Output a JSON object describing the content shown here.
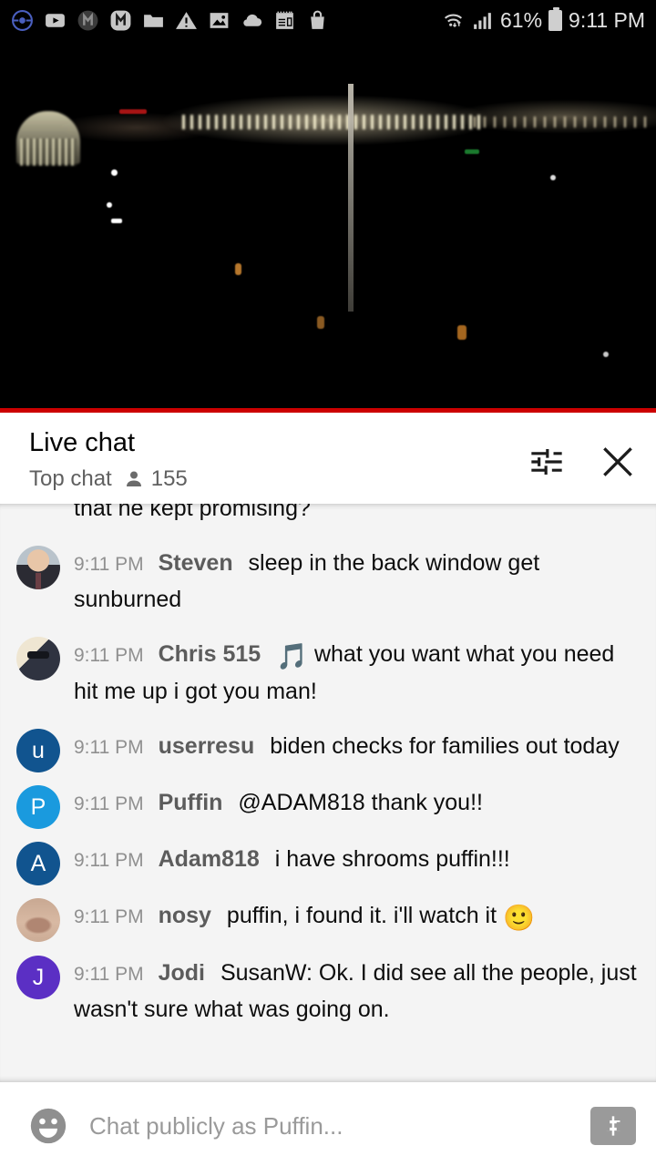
{
  "statusbar": {
    "icons": [
      {
        "name": "pokeball-icon"
      },
      {
        "name": "youtube-icon"
      },
      {
        "name": "m-circle-dark-icon"
      },
      {
        "name": "m-rounded-icon"
      },
      {
        "name": "folder-icon"
      },
      {
        "name": "warning-triangle-icon"
      },
      {
        "name": "image-icon"
      },
      {
        "name": "cloud-icon"
      },
      {
        "name": "notes-icon"
      },
      {
        "name": "shopping-bag-icon"
      }
    ],
    "wifi_icon": "wifi-icon",
    "signal_icon": "cell-signal-icon",
    "battery_percent": "61%",
    "battery_icon": "battery-icon",
    "clock": "9:11 PM"
  },
  "player": {
    "progress_color": "#cc0000",
    "progress_percent": 100
  },
  "chat": {
    "title": "Live chat",
    "mode_label": "Top chat",
    "viewer_icon": "person-icon",
    "viewer_count": "155",
    "settings_icon": "tune-icon",
    "close_icon": "close-icon",
    "messages": [
      {
        "clipped": true,
        "avatar": {
          "type": "none"
        },
        "time": "",
        "author": "",
        "text": "that he kept promising?"
      },
      {
        "avatar": {
          "type": "photo",
          "style": "ph-steven",
          "name": "avatar-steven"
        },
        "time": "9:11 PM",
        "author": "Steven",
        "text": "sleep in the back window get sunburned"
      },
      {
        "avatar": {
          "type": "photo",
          "style": "ph-chris",
          "name": "avatar-chris-515"
        },
        "time": "9:11 PM",
        "author": "Chris 515",
        "emoji": "🎵",
        "text": "what you want what you need hit me up i got you man!"
      },
      {
        "avatar": {
          "type": "letter",
          "letter": "u",
          "color": "#11548f",
          "name": "avatar-userresu"
        },
        "time": "9:11 PM",
        "author": "userresu",
        "text": "biden checks for families out today"
      },
      {
        "avatar": {
          "type": "letter",
          "letter": "P",
          "color": "#1a9ade",
          "name": "avatar-puffin"
        },
        "time": "9:11 PM",
        "author": "Puffin",
        "text": "@ADAM818 thank you!!"
      },
      {
        "avatar": {
          "type": "letter",
          "letter": "A",
          "color": "#11548f",
          "name": "avatar-adam818"
        },
        "time": "9:11 PM",
        "author": "Adam818",
        "text": "i have shrooms puffin!!!"
      },
      {
        "avatar": {
          "type": "photo",
          "style": "ph-nosy",
          "name": "avatar-nosy"
        },
        "time": "9:11 PM",
        "author": "nosy",
        "text": "puffin, i found it. i'll watch it ",
        "trailing_emoji": "🙂"
      },
      {
        "avatar": {
          "type": "letter",
          "letter": "J",
          "color": "#5b2fc4",
          "name": "avatar-jodi"
        },
        "time": "9:11 PM",
        "author": "Jodi",
        "text": "SusanW: Ok. I did see all the people, just wasn't sure what was going on."
      }
    ]
  },
  "composer": {
    "emoji_icon": "emoji-face-icon",
    "placeholder": "Chat publicly as Puffin...",
    "value": "",
    "superchat_icon": "dollar-icon"
  }
}
